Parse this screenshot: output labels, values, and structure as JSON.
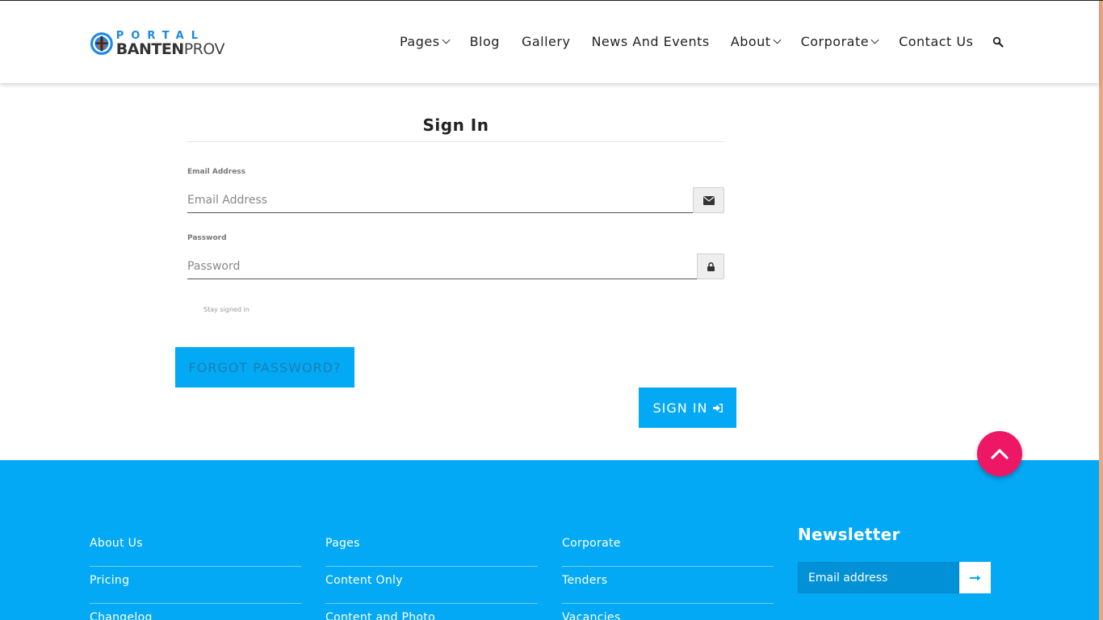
{
  "header": {
    "logo": {
      "top_text": "PORTAL",
      "bottom_bold": "BANTEN",
      "bottom_light": "PROV"
    },
    "nav": [
      {
        "label": "Pages",
        "dropdown": true
      },
      {
        "label": "Blog",
        "dropdown": false
      },
      {
        "label": "Gallery",
        "dropdown": false
      },
      {
        "label": "News And Events",
        "dropdown": false
      },
      {
        "label": "About",
        "dropdown": true
      },
      {
        "label": "Corporate",
        "dropdown": true
      },
      {
        "label": "Contact Us",
        "dropdown": false
      }
    ],
    "search_icon": "search-icon"
  },
  "signin": {
    "title": "Sign In",
    "email_label": "Email Address",
    "email_placeholder": "Email Address",
    "email_icon": "envelope-icon",
    "password_label": "Password",
    "password_placeholder": "Password",
    "password_icon": "lock-icon",
    "stay_signed_in": "Stay signed in",
    "forgot_button": "FORGOT PASSWORD?",
    "signin_button": "SIGN IN",
    "signin_icon": "sign-in-icon"
  },
  "back_to_top_icon": "chevron-up-icon",
  "footer": {
    "columns": [
      [
        "About Us",
        "Pricing",
        "Changelog"
      ],
      [
        "Pages",
        "Content Only",
        "Content and Photo"
      ],
      [
        "Corporate",
        "Tenders",
        "Vacancies"
      ]
    ],
    "newsletter": {
      "title": "Newsletter",
      "placeholder": "Email address",
      "submit_icon": "arrow-right-icon"
    }
  },
  "colors": {
    "primary": "#03a9f4",
    "accent": "#ee1765",
    "logo_blue": "#1e88e5",
    "forgot_text": "#1b7fb0"
  }
}
